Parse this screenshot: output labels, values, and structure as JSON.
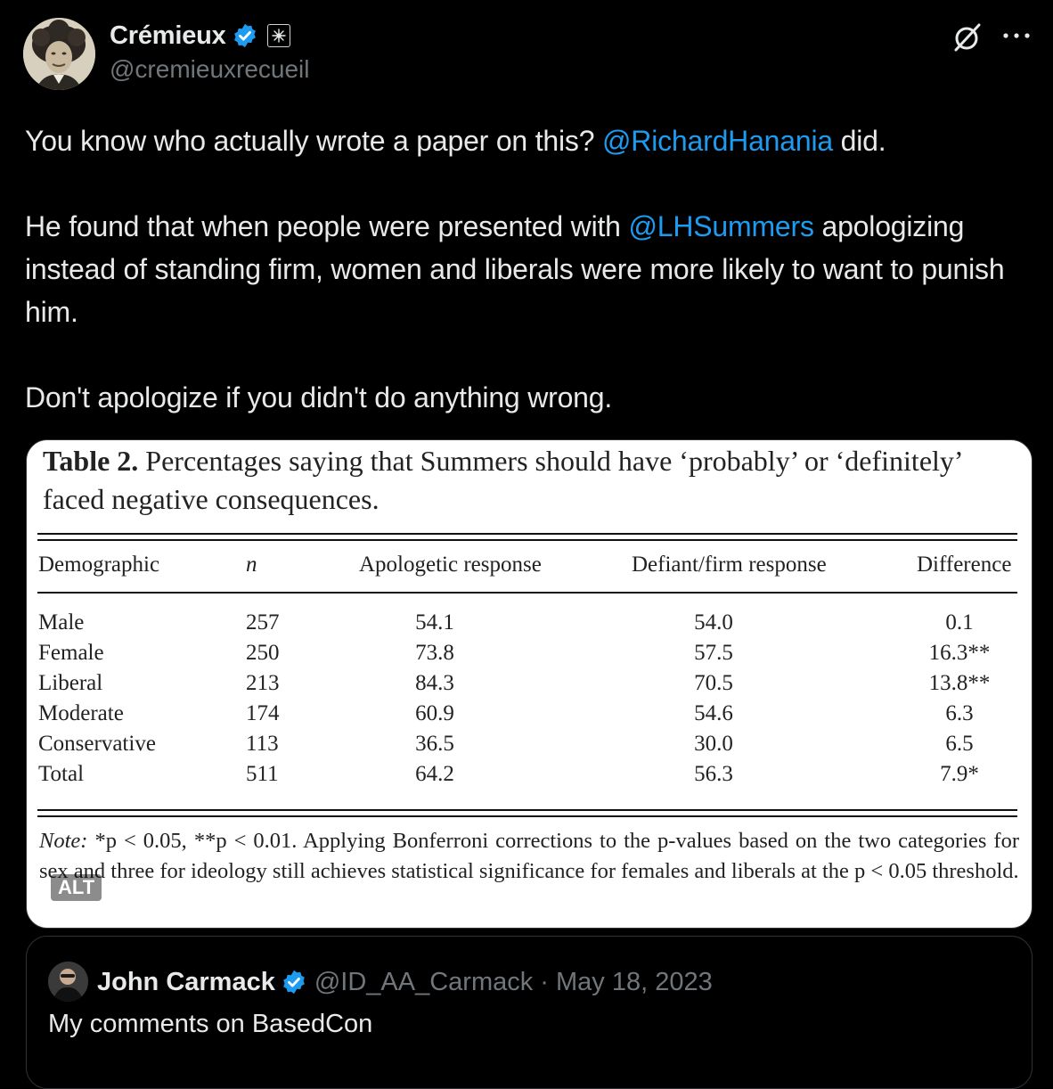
{
  "author": {
    "display_name": "Crémieux",
    "handle": "@cremieuxrecueil"
  },
  "tweet": {
    "p1_pre": "You know who actually wrote a paper on this? ",
    "p1_mention": "@RichardHanania",
    "p1_post": " did.",
    "p2_pre": "He found that when people were presented with ",
    "p2_mention": "@LHSummers",
    "p2_post": " apologizing instead of standing firm, women and liberals were more likely to want to punish him.",
    "p3": "Don't apologize if you didn't do anything wrong."
  },
  "media": {
    "table_label": "Table 2.",
    "table_caption": " Percentages saying that Summers should have ‘probably’ or ‘definitely’ faced negative consequences.",
    "columns": [
      "Demographic",
      "n",
      "Apologetic response",
      "Defiant/firm response",
      "Difference"
    ],
    "rows": [
      [
        "Male",
        "257",
        "54.1",
        "54.0",
        "0.1"
      ],
      [
        "Female",
        "250",
        "73.8",
        "57.5",
        "16.3**"
      ],
      [
        "Liberal",
        "213",
        "84.3",
        "70.5",
        "13.8**"
      ],
      [
        "Moderate",
        "174",
        "60.9",
        "54.6",
        "6.3"
      ],
      [
        "Conservative",
        "113",
        "36.5",
        "30.0",
        "6.5"
      ],
      [
        "Total",
        "511",
        "64.2",
        "56.3",
        "7.9*"
      ]
    ],
    "note_label": "Note:",
    "note_text": " *p < 0.05, **p < 0.01. Applying Bonferroni corrections to the p-values based on the two categories for sex and three for ideology still achieves statistical significance for females and liberals at the p < 0.05 threshold.",
    "alt_label": "ALT"
  },
  "quote": {
    "display_name": "John Carmack",
    "handle_date": "@ID_AA_Carmack · May 18, 2023",
    "text": "My comments on BasedCon"
  },
  "colors": {
    "background": "#000000",
    "text": "#e7e9ea",
    "secondary": "#71767b",
    "link": "#1d9bf0",
    "border": "#2f3336"
  },
  "icons": [
    "verified-badge-icon",
    "affiliation-badge-icon",
    "grok-icon",
    "more-icon"
  ]
}
